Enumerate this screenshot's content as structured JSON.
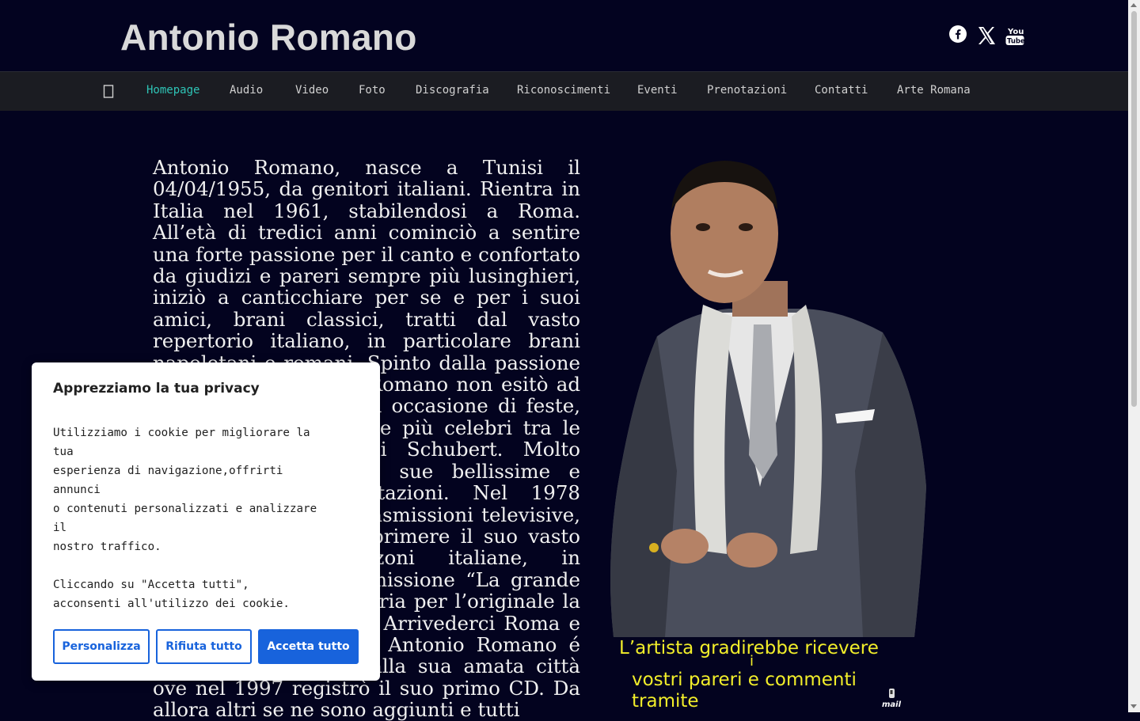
{
  "header": {
    "site_title": "Antonio Romano",
    "social": [
      "facebook-icon",
      "x-icon",
      "youtube-icon"
    ],
    "youtube_text_top": "You",
    "youtube_text_bottom": "Tube"
  },
  "nav": {
    "home_icon": "home-icon",
    "items": [
      {
        "label": "Homepage",
        "active": true
      },
      {
        "label": "Audio"
      },
      {
        "label": "Video"
      },
      {
        "label": "Foto"
      },
      {
        "label": "Discografia"
      },
      {
        "label": "Riconoscimenti"
      },
      {
        "label": "Eventi"
      },
      {
        "label": "Prenotazioni"
      },
      {
        "label": "Contatti"
      },
      {
        "label": "Arte Romana"
      }
    ]
  },
  "main": {
    "bio": "Antonio Romano, nasce a Tunisi il 04/04/1955, da genitori italiani. Rientra in Italia nel 1961, stabilendosi a Roma. All’età di tredici anni cominciò a sentire una forte passione per il canto e confortato da giudizi e pareri sempre più lusinghieri, iniziò a canticchiare per se e per i suoi amici, brani classici, tratti dal vasto repertorio italiano, in particolare brani napoletani e romani. Spinto dalla passione per il canto, Antonio Romano non esitò ad esibirsi in pubblico, in occasione di feste, cantando anche le arie più celebri tra le quali l’Ave Maria di Schubert. Molto apprezzate furono le sue bellissime e coinvolgenti interpretazioni. Nel 1978 partecipò a diverse trasmissioni televisive, ove ebbe modo di esprimere il suo vasto repertorio di canzoni italiane, in particolare nella trasmissione “La grande occasione” colpì la giuria per l’originale la sua interpretazione di Arrivederci Roma e di altri brani romani. Antonio Romano é sempre stato legato alla sua amata città ove nel 1997 registrò il suo primo CD. Da allora altri se ne sono aggiunti e tutti",
    "contact_line1": "L’artista gradirebbe ricevere",
    "contact_line1b": "i",
    "contact_line2": "vostri pareri e commenti",
    "contact_line3": "tramite",
    "mail_icon_label": "mail",
    "colors": {
      "background": "#03031f",
      "accent": "#2ec4b6",
      "contact_text": "#f2ee2a"
    }
  },
  "cookie": {
    "title": "Apprezziamo la tua privacy",
    "body1_l1": "Utilizziamo i cookie per migliorare la",
    "body1_l2": "tua",
    "body1_l3": "esperienza di navigazione,offrirti",
    "body1_l4": "annunci",
    "body1_l5": "o contenuti personalizzati e analizzare",
    "body1_l6": "il",
    "body1_l7": "nostro traffico.",
    "body2_l1": "Cliccando su \"Accetta tutti\",",
    "body2_l2": "acconsenti all'utilizzo dei cookie.",
    "btn_customize": "Personalizza",
    "btn_reject": "Rifiuta tutto",
    "btn_accept": "Accetta tutto",
    "colors": {
      "primary": "#1863dc"
    }
  }
}
